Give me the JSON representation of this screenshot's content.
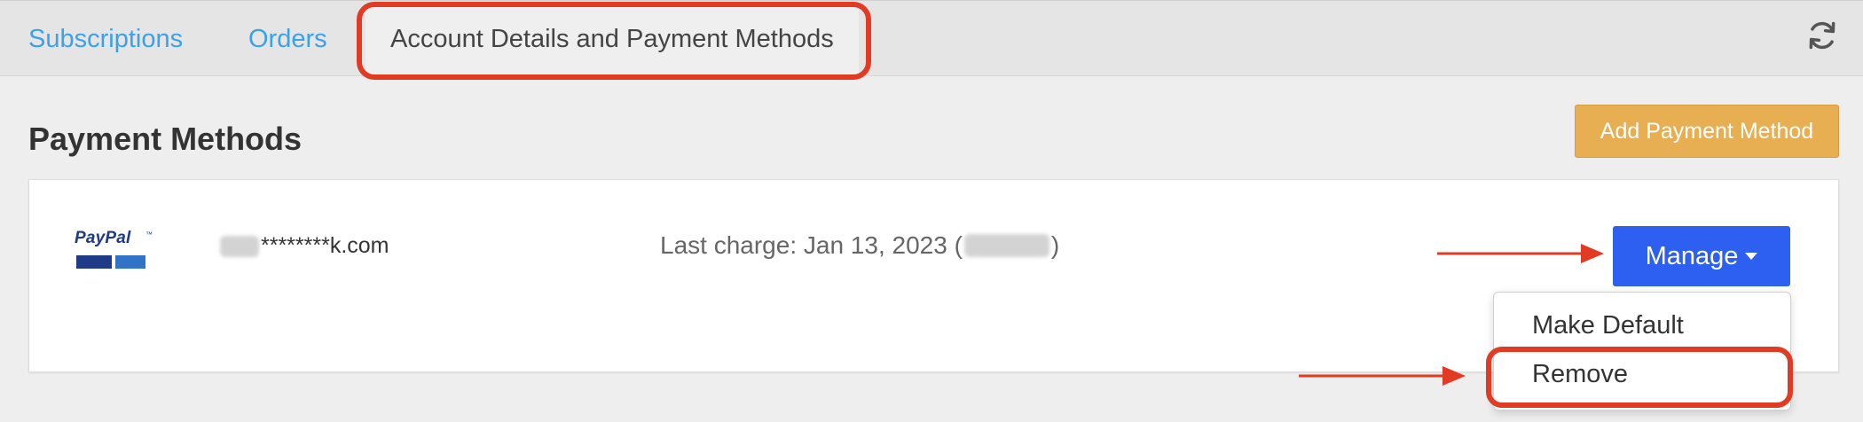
{
  "tabs": [
    {
      "label": "Subscriptions"
    },
    {
      "label": "Orders"
    },
    {
      "label": "Account Details and Payment Methods",
      "active": true
    }
  ],
  "refresh_icon": "refresh-icon",
  "section": {
    "title": "Payment Methods",
    "add_button": "Add Payment Method"
  },
  "payment_method": {
    "provider": "PayPal",
    "provider_tm": "™",
    "email_suffix": "********k.com",
    "last_charge_prefix": "Last charge: Jan 13, 2023 (",
    "last_charge_suffix": ")",
    "manage_button": "Manage",
    "menu": [
      {
        "label": "Make Default"
      },
      {
        "label": "Remove"
      }
    ]
  },
  "colors": {
    "accent_blue": "#2d5ff1",
    "link_blue": "#3ba1e8",
    "add_orange": "#e8ae52",
    "annotation_red": "#e23b24"
  }
}
